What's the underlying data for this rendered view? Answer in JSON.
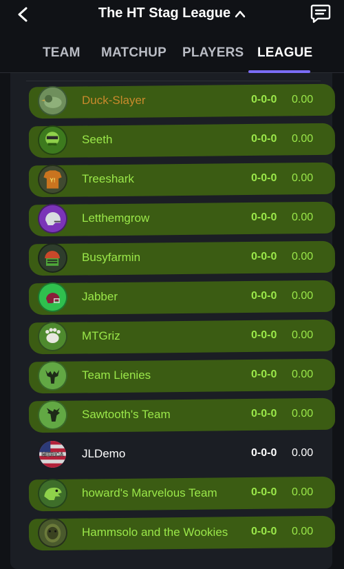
{
  "header": {
    "title": "The HT Stag League",
    "back_icon": "chevron-left-icon",
    "caret_icon": "chevron-up-icon",
    "chat_icon": "chat-icon"
  },
  "tabs": [
    {
      "label": "TEAM",
      "active": false
    },
    {
      "label": "MATCHUP",
      "active": false
    },
    {
      "label": "PLAYERS",
      "active": false
    },
    {
      "label": "LEAGUE",
      "active": true
    }
  ],
  "colors": {
    "accent": "#7b6cf6",
    "highlight": "#3f6312",
    "team_text": "#9be84a",
    "user_team": "#c98a2c"
  },
  "standings": [
    {
      "name": "Duck-Slayer",
      "record": "0-0-0",
      "points": "0.00",
      "avatar": "duck-avatar-icon",
      "highlighted": true,
      "style": "orange"
    },
    {
      "name": "Seeth",
      "record": "0-0-0",
      "points": "0.00",
      "avatar": "zombie-avatar-icon",
      "highlighted": true,
      "style": "green"
    },
    {
      "name": "Treeshark",
      "record": "0-0-0",
      "points": "0.00",
      "avatar": "jersey-avatar-icon",
      "highlighted": true,
      "style": "green"
    },
    {
      "name": "Letthemgrow",
      "record": "0-0-0",
      "points": "0.00",
      "avatar": "helmet-avatar-icon",
      "highlighted": true,
      "style": "green"
    },
    {
      "name": "Busyfarmin",
      "record": "0-0-0",
      "points": "0.00",
      "avatar": "robot-helmet-avatar-icon",
      "highlighted": true,
      "style": "green"
    },
    {
      "name": "Jabber",
      "record": "0-0-0",
      "points": "0.00",
      "avatar": "red-helmet-avatar-icon",
      "highlighted": true,
      "style": "green"
    },
    {
      "name": "MTGriz",
      "record": "0-0-0",
      "points": "0.00",
      "avatar": "paw-avatar-icon",
      "highlighted": true,
      "style": "green"
    },
    {
      "name": "Team Lienies",
      "record": "0-0-0",
      "points": "0.00",
      "avatar": "moose-avatar-icon",
      "highlighted": true,
      "style": "green"
    },
    {
      "name": "Sawtooth's Team",
      "record": "0-0-0",
      "points": "0.00",
      "avatar": "elk-avatar-icon",
      "highlighted": true,
      "style": "green"
    },
    {
      "name": "JLDemo",
      "record": "0-0-0",
      "points": "0.00",
      "avatar": "merica-flag-avatar-icon",
      "highlighted": false,
      "style": "white",
      "avatar_text": "MERICA"
    },
    {
      "name": "howard's Marvelous Team",
      "record": "0-0-0",
      "points": "0.00",
      "avatar": "dinosaur-avatar-icon",
      "highlighted": true,
      "style": "green"
    },
    {
      "name": "Hammsolo and the Wookies",
      "record": "0-0-0",
      "points": "0.00",
      "avatar": "wookie-avatar-icon",
      "highlighted": true,
      "style": "green"
    }
  ]
}
